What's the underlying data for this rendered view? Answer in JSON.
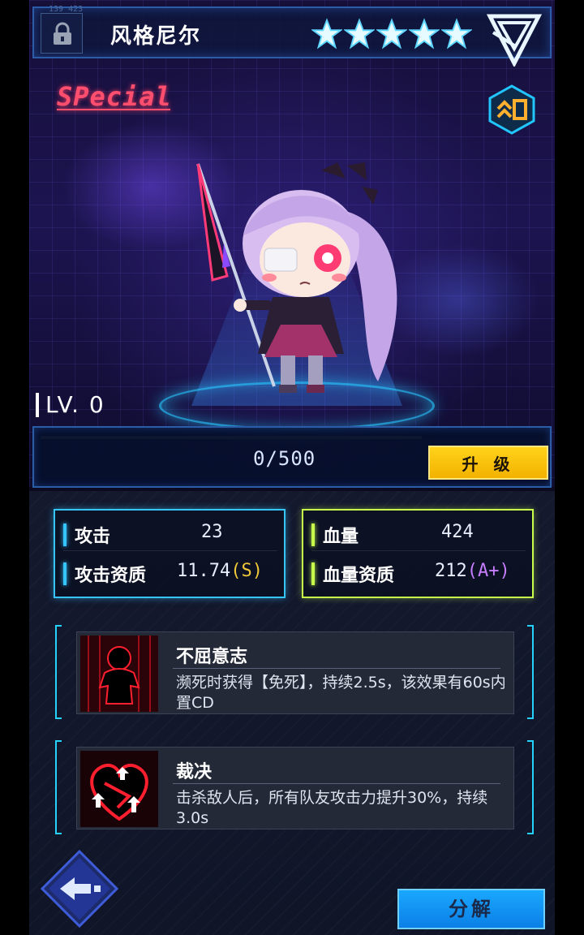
{
  "header": {
    "code": "139 423",
    "character_name": "风格尼尔",
    "star_count": 5,
    "lock_icon": "lock-icon",
    "faction_icon": "triangle-emblem-icon"
  },
  "rarity": "SPecial",
  "rank_badge": "^0",
  "level": {
    "label": "LV. 0"
  },
  "experience": {
    "text": "0/500",
    "progress": 0
  },
  "upgrade_label": "升 级",
  "stats": {
    "attack": {
      "label": "攻击",
      "value": "23",
      "aptitude_label": "攻击资质",
      "aptitude_value": "11.74",
      "aptitude_grade": "(S)",
      "grade_color": "#f0c83a"
    },
    "hp": {
      "label": "血量",
      "value": "424",
      "aptitude_label": "血量资质",
      "aptitude_value": "212",
      "aptitude_grade": "(A+)",
      "grade_color": "#c77dff"
    }
  },
  "skills": [
    {
      "name": "不屈意志",
      "description": "濒死时获得【免死】，持续2.5s，该效果有60s内置CD",
      "icon": "silhouette-icon"
    },
    {
      "name": "裁决",
      "description": "击杀敌人后，所有队友攻击力提升30%，持续3.0s",
      "icon": "broken-heart-arrows-icon"
    }
  ],
  "back_icon": "arrow-left-icon",
  "decompose_label": "分解",
  "colors": {
    "accent_cyan": "#25d1ff",
    "accent_yellow": "#ffd21a",
    "accent_green": "#c7ff4a",
    "special_red": "#ff4e6e"
  }
}
